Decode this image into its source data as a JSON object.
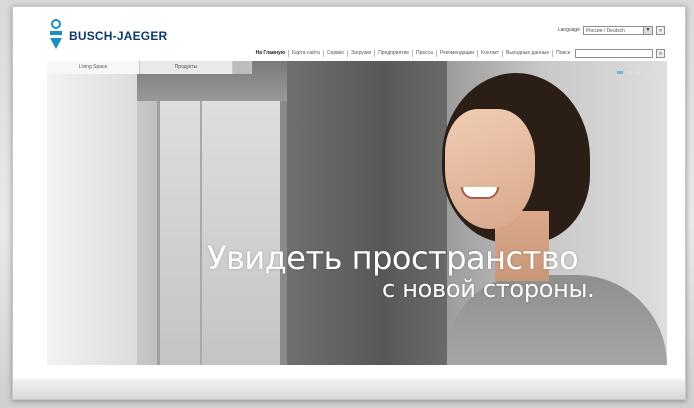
{
  "brand": {
    "name": "BUSCH-JAEGER",
    "colors": {
      "accent": "#0c3a6b",
      "slider_active": "#57b8c9"
    }
  },
  "language": {
    "label": "Language",
    "selected": "Россия / Deutsch",
    "go_label": "»"
  },
  "nav": {
    "items": [
      {
        "label": "На Главную",
        "active": true
      },
      {
        "label": "Карта сайта",
        "active": false
      },
      {
        "label": "Сервис",
        "active": false
      },
      {
        "label": "Загрузки",
        "active": false
      },
      {
        "label": "Предприятие",
        "active": false
      },
      {
        "label": "Пресса",
        "active": false
      },
      {
        "label": "Рекомендации",
        "active": false
      },
      {
        "label": "Контакт",
        "active": false
      },
      {
        "label": "Выходные данные",
        "active": false
      },
      {
        "label": "Поиск",
        "active": false
      }
    ],
    "search_placeholder": "",
    "search_button_label": "»"
  },
  "hero": {
    "tabs": [
      {
        "label": "Living Space",
        "active": true
      },
      {
        "label": "Продукты",
        "active": false
      }
    ],
    "slides": {
      "count": 5,
      "active_index": 0
    },
    "headline": "Увидеть пространство",
    "subline": "с новой стороны."
  },
  "icons": {
    "logo": "busch-jaeger-logo-icon"
  }
}
